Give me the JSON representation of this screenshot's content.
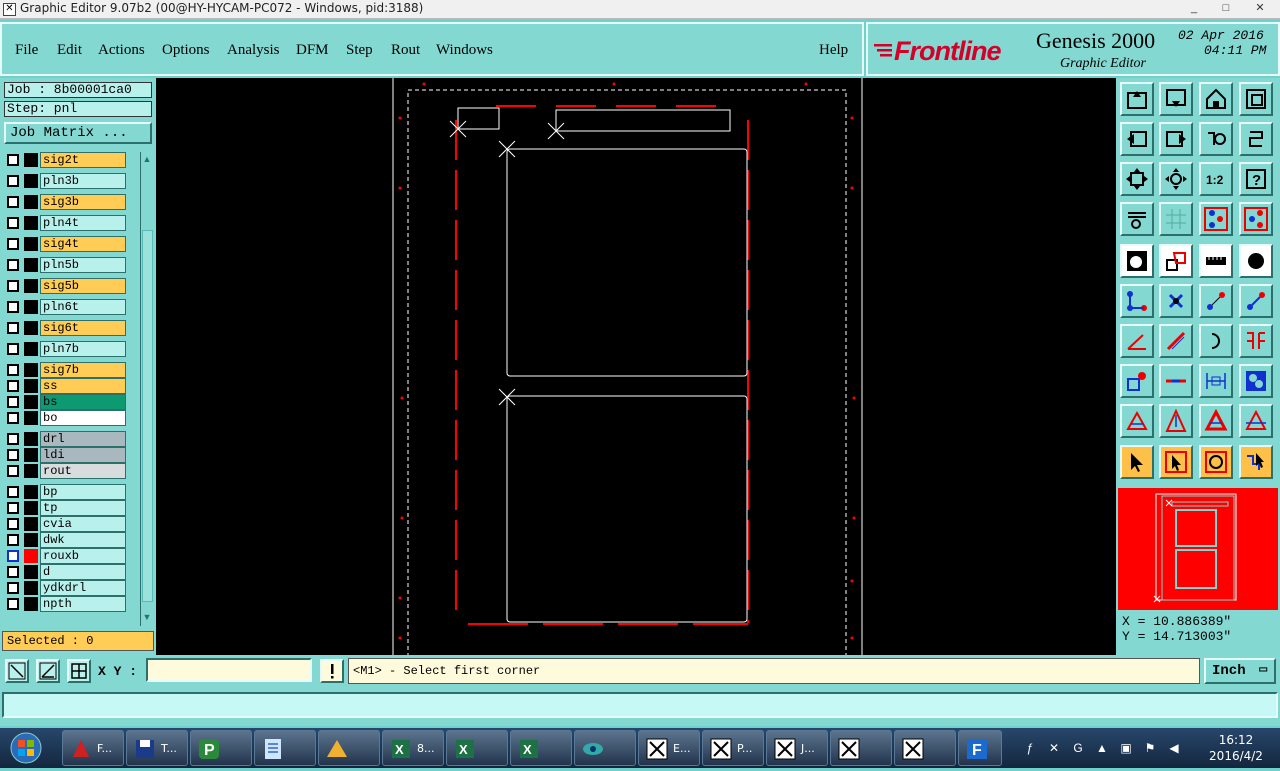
{
  "window": {
    "title": "Graphic Editor 9.07b2 (00@HY-HYCAM-PC072 - Windows, pid:3188)",
    "controls": [
      "_",
      "□",
      "✕"
    ]
  },
  "menu": {
    "items": [
      "File",
      "Edit",
      "Actions",
      "Options",
      "Analysis",
      "DFM",
      "Step",
      "Rout",
      "Windows"
    ],
    "help": "Help"
  },
  "brand": {
    "logo": "Frontline",
    "product": "Genesis 2000",
    "subtitle": "Graphic Editor",
    "date": "02 Apr 2016",
    "time": "04:11 PM"
  },
  "left": {
    "job": "Job : 8b00001ca0",
    "step": "Step: pnl",
    "job_matrix": "Job Matrix ...",
    "selected": "Selected : 0"
  },
  "layers": [
    {
      "name": "sig2t",
      "bg": "#ffcc55"
    },
    {
      "name": "pln3b",
      "bg": "#b8f0ec"
    },
    {
      "name": "sig3b",
      "bg": "#ffcc55"
    },
    {
      "name": "pln4t",
      "bg": "#b8f0ec"
    },
    {
      "name": "sig4t",
      "bg": "#ffcc55"
    },
    {
      "name": "pln5b",
      "bg": "#b8f0ec"
    },
    {
      "name": "sig5b",
      "bg": "#ffcc55"
    },
    {
      "name": "pln6t",
      "bg": "#b8f0ec"
    },
    {
      "name": "sig6t",
      "bg": "#ffcc55"
    },
    {
      "name": "pln7b",
      "bg": "#b8f0ec"
    },
    {
      "name": "sig7b",
      "bg": "#ffcc55"
    },
    {
      "name": "ss",
      "bg": "#ffcc55"
    },
    {
      "name": "bs",
      "bg": "#0e9a70"
    },
    {
      "name": "bo",
      "bg": "#ffffff"
    },
    {
      "name": "drl",
      "bg": "#a9b7be"
    },
    {
      "name": "ldi",
      "bg": "#a9b7be"
    },
    {
      "name": "rout",
      "bg": "#d8dcdc"
    },
    {
      "name": "bp",
      "bg": "#b8f0ec"
    },
    {
      "name": "tp",
      "bg": "#b8f0ec"
    },
    {
      "name": "cvia",
      "bg": "#b8f0ec"
    },
    {
      "name": "dwk",
      "bg": "#b8f0ec"
    },
    {
      "name": "rouxb",
      "bg": "#b8f0ec"
    },
    {
      "name": "d",
      "bg": "#b8f0ec"
    },
    {
      "name": "ydkdrl",
      "bg": "#b8f0ec"
    },
    {
      "name": "npth",
      "bg": "#b8f0ec"
    }
  ],
  "coords": {
    "x": "X = 10.886389\"",
    "y": "Y = 14.713003\""
  },
  "command": {
    "xy_label": "X Y :",
    "xy_value": "",
    "prompt": "<M1> - Select first corner",
    "units": "Inch"
  },
  "taskbar": {
    "buttons": [
      "F...",
      "T...",
      "",
      "",
      "",
      "8...",
      "",
      "",
      "",
      "E...",
      "P...",
      "J...",
      "",
      ""
    ],
    "clock_time": "16:12",
    "clock_date": "2016/4/2"
  },
  "colors": {
    "panel": "#83d8d2",
    "canvas": "#000000",
    "route": "#ff0000",
    "highlight": "#ffcc55"
  }
}
